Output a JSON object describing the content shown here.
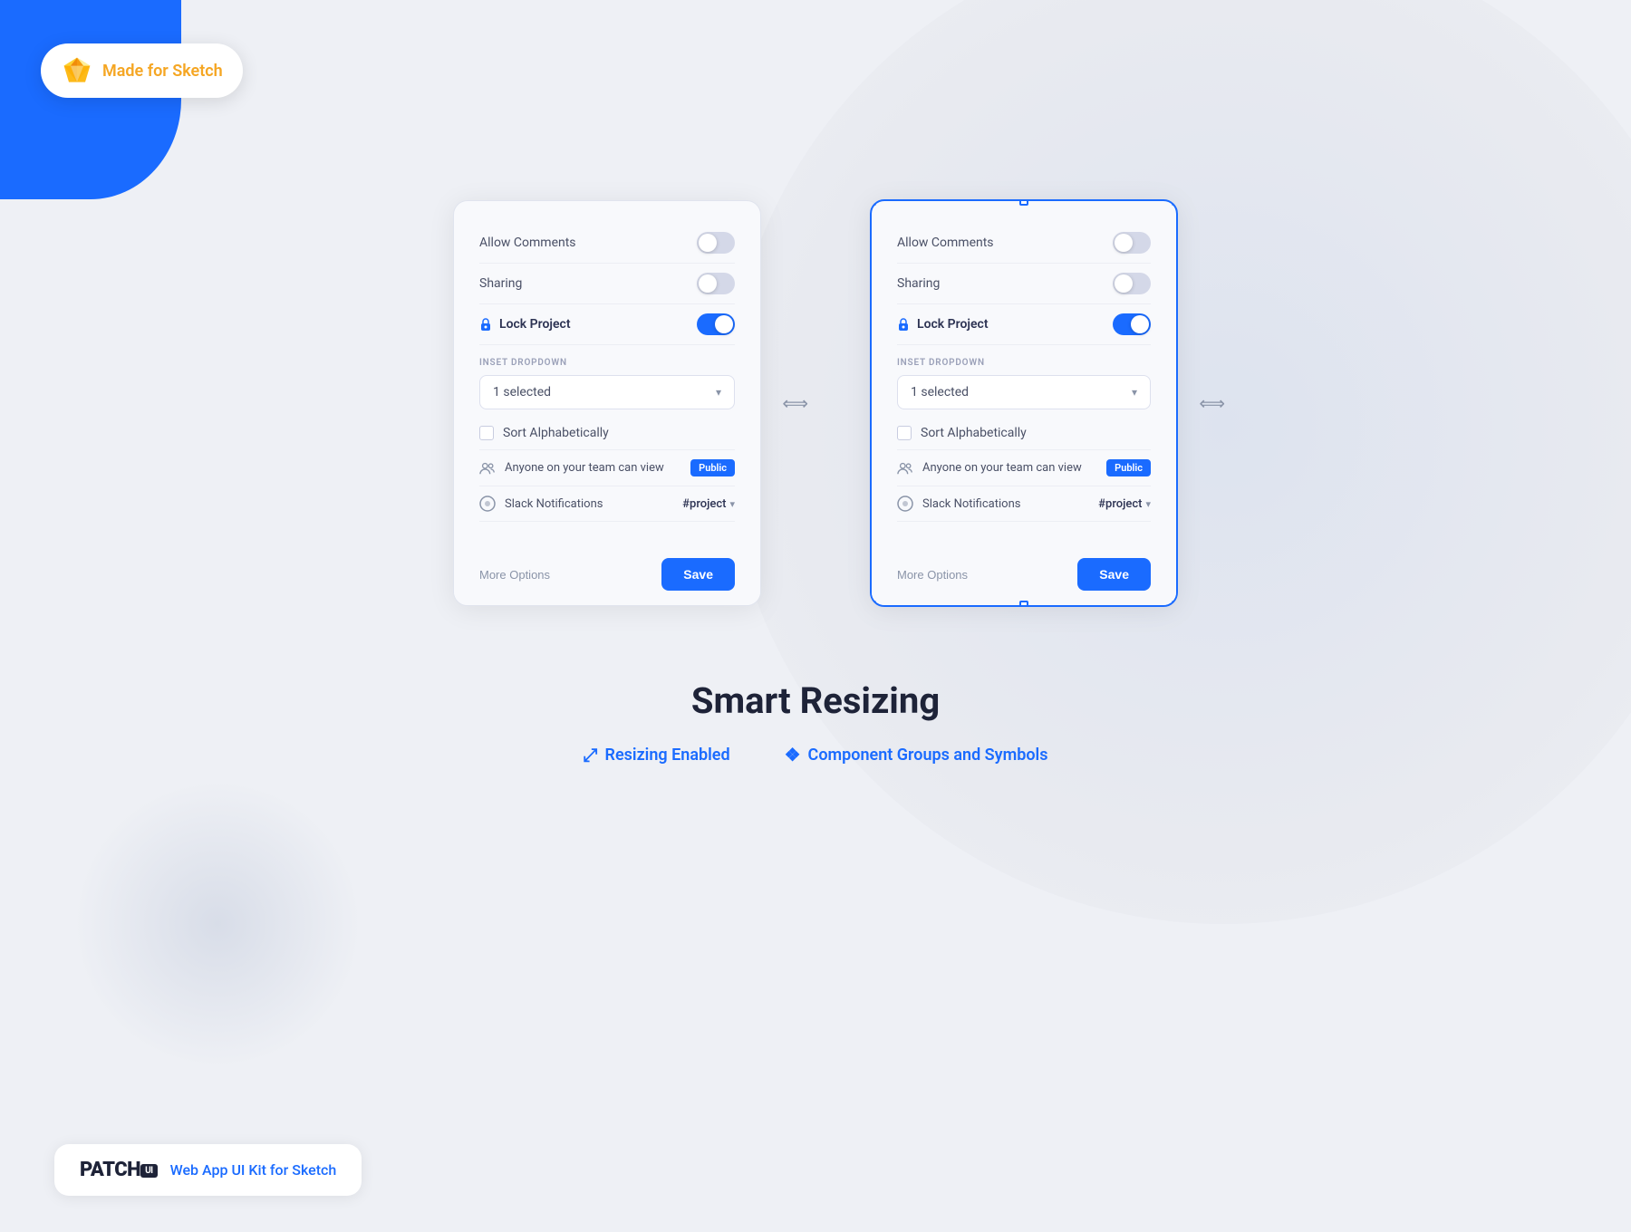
{
  "badge": {
    "text": "Made for Sketch"
  },
  "card1": {
    "toggle_allow_comments": "Allow Comments",
    "toggle_sharing": "Sharing",
    "toggle_lock_project": "Lock Project",
    "section_label": "INSET DROPDOWN",
    "dropdown_value": "1 selected",
    "checkbox_label": "Sort Alphabetically",
    "info_anyone": "Anyone on your team can view",
    "badge_public": "Public",
    "slack_label": "Slack Notifications",
    "slack_value": "#project",
    "more_options": "More Options",
    "save": "Save"
  },
  "card2": {
    "toggle_allow_comments": "Allow Comments",
    "toggle_sharing": "Sharing",
    "toggle_lock_project": "Lock Project",
    "section_label": "INSET DROPDOWN",
    "dropdown_value": "1 selected",
    "checkbox_label": "Sort Alphabetically",
    "info_anyone": "Anyone on your team can view",
    "badge_public": "Public",
    "slack_label": "Slack Notifications",
    "slack_value": "#project",
    "more_options": "More Options",
    "save": "Save"
  },
  "bottom": {
    "title": "Smart Resizing",
    "feature1": "Resizing Enabled",
    "feature2": "Component Groups and Symbols"
  },
  "branding": {
    "patch": "PATCH",
    "ui_badge": "UI",
    "tagline": "Web App UI Kit for Sketch"
  }
}
